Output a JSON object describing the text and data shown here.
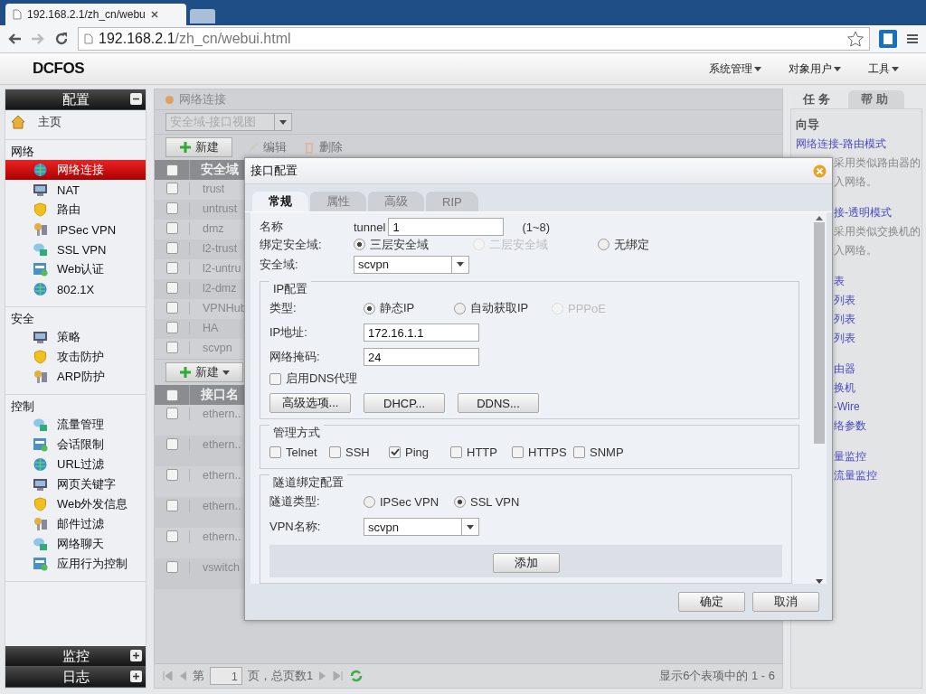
{
  "browser": {
    "tab_title": "192.168.2.1/zh_cn/webu",
    "url_host": "192.168.2.1",
    "url_path": "/zh_cn/webui.html"
  },
  "app": {
    "logo": "DCFOS",
    "menus": [
      "系统管理",
      "对象用户",
      "工具"
    ]
  },
  "sidebar": {
    "top_panel": {
      "title": "配置",
      "expanded": true
    },
    "home": "主页",
    "groups": [
      {
        "title": "网络",
        "items": [
          {
            "label": "网络连接",
            "selected": true
          },
          {
            "label": "NAT",
            "selected": false
          },
          {
            "label": "路由",
            "selected": false
          },
          {
            "label": "IPSec VPN",
            "selected": false
          },
          {
            "label": "SSL VPN",
            "selected": false
          },
          {
            "label": "Web认证",
            "selected": false
          },
          {
            "label": "802.1X",
            "selected": false
          }
        ]
      },
      {
        "title": "安全",
        "items": [
          {
            "label": "策略",
            "selected": false
          },
          {
            "label": "攻击防护",
            "selected": false
          },
          {
            "label": "ARP防护",
            "selected": false
          }
        ]
      },
      {
        "title": "控制",
        "items": [
          {
            "label": "流量管理",
            "selected": false
          },
          {
            "label": "会话限制",
            "selected": false
          },
          {
            "label": "URL过滤",
            "selected": false
          },
          {
            "label": "网页关键字",
            "selected": false
          },
          {
            "label": "Web外发信息",
            "selected": false
          },
          {
            "label": "邮件过滤",
            "selected": false
          },
          {
            "label": "网络聊天",
            "selected": false
          },
          {
            "label": "应用行为控制",
            "selected": false
          }
        ]
      }
    ],
    "bottom_panels": [
      {
        "title": "监控",
        "expanded": false
      },
      {
        "title": "日志",
        "expanded": false
      }
    ]
  },
  "main": {
    "breadcrumb": "网络连接",
    "view_select": "安全域-接口视图",
    "toolbar": [
      {
        "label": "新建",
        "disabled": false
      },
      {
        "label": "编辑",
        "disabled": true
      },
      {
        "label": "删除",
        "disabled": true
      }
    ],
    "zone_table": {
      "header": "安全域",
      "header_checked": false,
      "rows": [
        {
          "name": "trust",
          "checked": false
        },
        {
          "name": "untrust",
          "checked": false
        },
        {
          "name": "dmz",
          "checked": false
        },
        {
          "name": "l2-trust",
          "checked": false
        },
        {
          "name": "l2-untru",
          "checked": false
        },
        {
          "name": "l2-dmz",
          "checked": false
        },
        {
          "name": "VPNHub",
          "checked": false
        },
        {
          "name": "HA",
          "checked": false
        },
        {
          "name": "scvpn",
          "checked": false
        }
      ]
    },
    "iface_toolbar": {
      "label": "新建"
    },
    "iface_table": {
      "header": "接口名",
      "header_checked": false,
      "rows": [
        {
          "name": "ethern..",
          "checked": false
        },
        {
          "name": "ethern..",
          "checked": false
        },
        {
          "name": "ethern..",
          "checked": false
        },
        {
          "name": "ethern..",
          "checked": false
        },
        {
          "name": "ethern..",
          "checked": false
        },
        {
          "name": "vswitch",
          "checked": false
        }
      ]
    },
    "pager": {
      "page_prefix": "第",
      "page": "1",
      "page_suffix": "页，总页数1",
      "summary": "显示6个表项中的 1 - 6"
    }
  },
  "right_panel": {
    "tabs": [
      {
        "label": "任务",
        "selected": true
      },
      {
        "label": "帮助",
        "selected": false
      }
    ],
    "heading": "向导",
    "sections": [
      [
        {
          "kind": "link",
          "text": "网络连接-路由模式"
        },
        {
          "kind": "cut_text",
          "text": "采用类似路由器的"
        },
        {
          "kind": "cut_text",
          "text": "入网络。"
        }
      ],
      [
        {
          "kind": "cut_link",
          "text": "接-透明模式"
        },
        {
          "kind": "cut_text",
          "text": "采用类似交换机的"
        },
        {
          "kind": "cut_text",
          "text": "入网络。"
        }
      ],
      [
        {
          "kind": "cut_link",
          "text": "表"
        },
        {
          "kind": "cut_link",
          "text": "列表"
        },
        {
          "kind": "cut_link",
          "text": "列表"
        },
        {
          "kind": "cut_link",
          "text": "列表"
        }
      ],
      [
        {
          "kind": "cut_link",
          "text": "由器"
        },
        {
          "kind": "cut_link",
          "text": "换机"
        },
        {
          "kind": "cut_link",
          "text": "-Wire"
        },
        {
          "kind": "cut_link",
          "text": "络参数"
        }
      ],
      [
        {
          "kind": "cut_link",
          "text": "量监控"
        },
        {
          "kind": "cut_link",
          "text": "流量监控"
        }
      ]
    ]
  },
  "modal": {
    "title": "接口配置",
    "tabs": [
      {
        "label": "常规",
        "selected": true
      },
      {
        "label": "属性",
        "selected": false
      },
      {
        "label": "高级",
        "selected": false
      },
      {
        "label": "RIP",
        "selected": false
      }
    ],
    "name": {
      "label": "名称",
      "prefix": "tunnel",
      "value": "1",
      "hint": "(1~8)"
    },
    "bind_zone": {
      "label": "绑定安全域:",
      "options": [
        {
          "label": "三层安全域",
          "selected": true,
          "disabled": false
        },
        {
          "label": "二层安全域",
          "selected": false,
          "disabled": true
        },
        {
          "label": "无绑定",
          "selected": false,
          "disabled": false
        }
      ]
    },
    "zone": {
      "label": "安全域:",
      "value": "scvpn"
    },
    "ip_config": {
      "title": "IP配置",
      "type": {
        "label": "类型:",
        "options": [
          {
            "label": "静态IP",
            "selected": true,
            "disabled": false
          },
          {
            "label": "自动获取IP",
            "selected": false,
            "disabled": false
          },
          {
            "label": "PPPoE",
            "selected": false,
            "disabled": true
          }
        ]
      },
      "ip": {
        "label": "IP地址:",
        "value": "172.16.1.1"
      },
      "mask": {
        "label": "网络掩码:",
        "value": "24"
      },
      "dns_proxy": {
        "label": "启用DNS代理",
        "checked": false
      },
      "buttons": [
        "高级选项...",
        "DHCP...",
        "DDNS..."
      ]
    },
    "management": {
      "title": "管理方式",
      "options": [
        {
          "label": "Telnet",
          "checked": false
        },
        {
          "label": "SSH",
          "checked": false
        },
        {
          "label": "Ping",
          "checked": true
        },
        {
          "label": "HTTP",
          "checked": false
        },
        {
          "label": "HTTPS",
          "checked": false
        },
        {
          "label": "SNMP",
          "checked": false
        }
      ]
    },
    "tunnel": {
      "title": "隧道绑定配置",
      "type": {
        "label": "隧道类型:",
        "options": [
          {
            "label": "IPSec VPN",
            "selected": false,
            "disabled": false
          },
          {
            "label": "SSL VPN",
            "selected": true,
            "disabled": false
          }
        ]
      },
      "vpn": {
        "label": "VPN名称:",
        "value": "scvpn"
      },
      "add_button": "添加"
    },
    "footer": [
      "确定",
      "取消"
    ]
  }
}
